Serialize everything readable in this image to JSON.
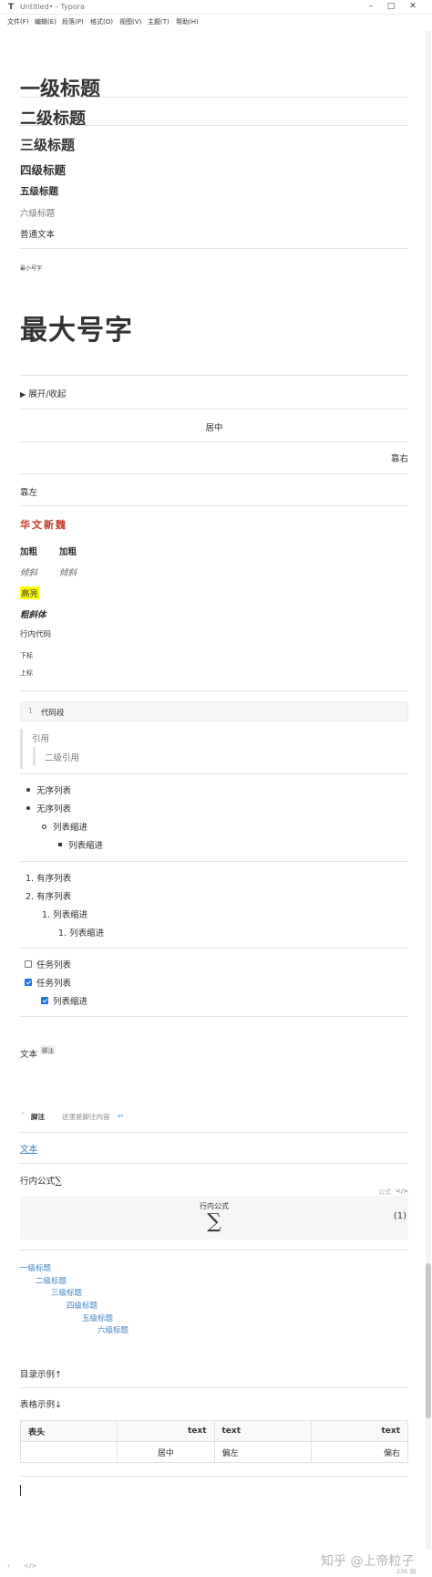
{
  "app": {
    "icon": "T",
    "title": "Untitled• - Typora"
  },
  "menu": [
    "文件(F)",
    "编辑(E)",
    "段落(P)",
    "格式(O)",
    "视图(V)",
    "主题(T)",
    "帮助(H)"
  ],
  "headings": {
    "h1": "一级标题",
    "h2": "二级标题",
    "h3": "三级标题",
    "h4": "四级标题",
    "h5": "五级标题",
    "h6": "六级标题",
    "normal": "普通文本"
  },
  "sizes": {
    "smallest": "最小号字",
    "largest": "最大号字"
  },
  "details": {
    "summary": "展开/收起"
  },
  "align": {
    "center": "居中",
    "right": "靠右",
    "left": "靠左"
  },
  "styled": {
    "font_sample": "华文新魏",
    "font_color": "#c0392b",
    "bold": "加粗",
    "italic": "倾斜",
    "highlight": "高亮",
    "highlight_color": "#ffff00",
    "bold_italic": "粗斜体",
    "inline_code": "行内代码",
    "subscript": "下标",
    "superscript": "上标"
  },
  "codeblock": {
    "line_no": "1",
    "code": "代码段"
  },
  "quote": {
    "level1": "引用",
    "level2": "二级引用"
  },
  "unordered": [
    "无序列表",
    "无序列表",
    "列表缩进",
    "列表缩进"
  ],
  "ordered": [
    {
      "marker": "1.",
      "text": "有序列表"
    },
    {
      "marker": "2.",
      "text": "有序列表"
    },
    {
      "marker": "1.",
      "text": "列表缩进"
    },
    {
      "marker": "1.",
      "text": "列表缩进"
    }
  ],
  "tasks": [
    {
      "text": "任务列表",
      "checked": false
    },
    {
      "text": "任务列表",
      "checked": true
    },
    {
      "text": "列表缩进",
      "checked": true
    }
  ],
  "footnote": {
    "text": "文本",
    "ref": "脚注",
    "caret": "^",
    "def_label": "脚注",
    "def_text": "这里是脚注内容",
    "back": "↩"
  },
  "link": {
    "text": "文本"
  },
  "math": {
    "inline_label": "行内公式",
    "sigma": "∑",
    "block_tag": "公式",
    "block_code_icon": "</>",
    "block_label": "行内公式",
    "number": "(1)"
  },
  "toc": [
    "一级标题",
    "二级标题",
    "三级标题",
    "四级标题",
    "五级标题",
    "六级标题"
  ],
  "toc_example": "目录示例↑",
  "table_example": "表格示例↓",
  "table": {
    "headers": [
      "表头",
      "text",
      "text",
      "text"
    ],
    "row": [
      "",
      "居中",
      "偏左",
      "偏右"
    ]
  },
  "status": {
    "code_icon": "</>",
    "watermark": "知乎 @上帝粒子",
    "wordcount": "235 词"
  },
  "colors": {
    "link": "#4183c4",
    "accent": "#1e73e8"
  }
}
